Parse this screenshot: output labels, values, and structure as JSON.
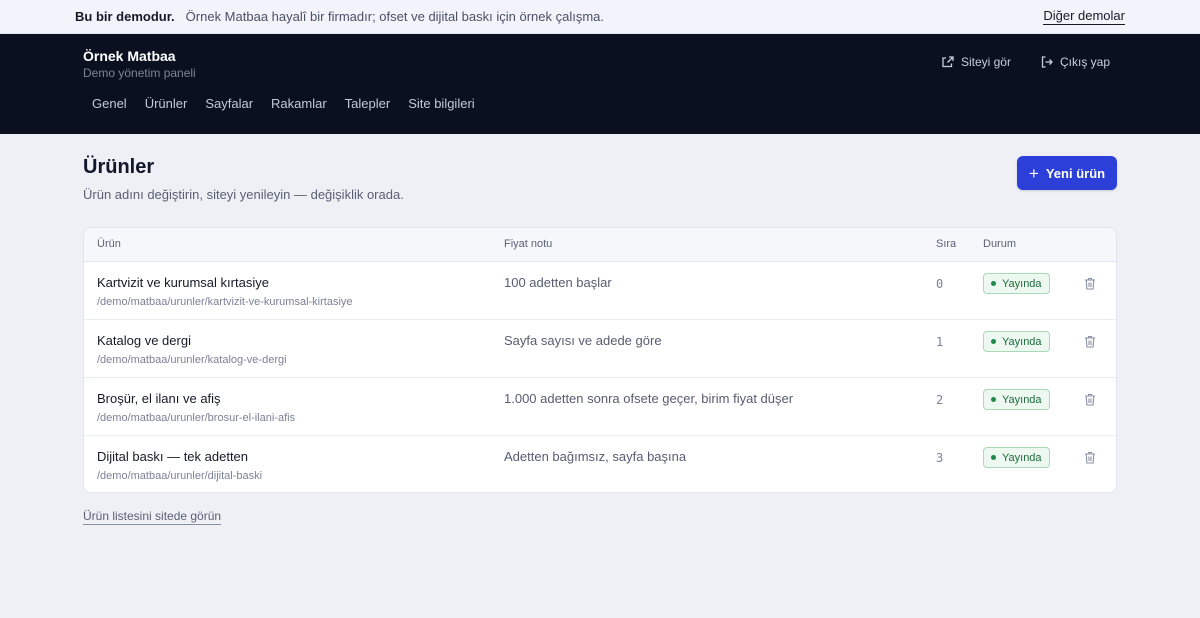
{
  "demo_bar": {
    "title": "Bu bir demodur.",
    "text": "Örnek Matbaa hayalî bir firmadır; ofset ve dijital baskı için örnek çalışma.",
    "link": "Diğer demolar"
  },
  "header": {
    "brand": "Örnek Matbaa",
    "subtitle": "Demo yönetim paneli",
    "actions": [
      {
        "label": "Siteyi gör",
        "icon": "external-link-icon"
      },
      {
        "label": "Çıkış yap",
        "icon": "logout-icon"
      }
    ],
    "nav": [
      "Genel",
      "Ürünler",
      "Sayfalar",
      "Rakamlar",
      "Talepler",
      "Site bilgileri"
    ]
  },
  "page": {
    "title": "Ürünler",
    "subtitle": "Ürün adını değiştirin, siteyi yenileyin — değişiklik orada.",
    "new_button": "Yeni ürün",
    "footer_link": "Ürün listesini sitede görün"
  },
  "table": {
    "columns": {
      "product": "Ürün",
      "price_note": "Fiyat notu",
      "order": "Sıra",
      "status": "Durum"
    },
    "rows": [
      {
        "name": "Kartvizit ve kurumsal kırtasiye",
        "path": "/demo/matbaa/urunler/kartvizit-ve-kurumsal-kirtasiye",
        "price_note": "100 adetten başlar",
        "order": "0",
        "status": "Yayında"
      },
      {
        "name": "Katalog ve dergi",
        "path": "/demo/matbaa/urunler/katalog-ve-dergi",
        "price_note": "Sayfa sayısı ve adede göre",
        "order": "1",
        "status": "Yayında"
      },
      {
        "name": "Broşür, el ilanı ve afiş",
        "path": "/demo/matbaa/urunler/brosur-el-ilani-afis",
        "price_note": "1.000 adetten sonra ofsete geçer, birim fiyat düşer",
        "order": "2",
        "status": "Yayında"
      },
      {
        "name": "Dijital baskı — tek adetten",
        "path": "/demo/matbaa/urunler/dijital-baski",
        "price_note": "Adetten bağımsız, sayfa başına",
        "order": "3",
        "status": "Yayında"
      }
    ]
  },
  "colors": {
    "header_bg": "#0b1020",
    "primary": "#2c3fd9",
    "status_green": "#1f8a4a"
  }
}
